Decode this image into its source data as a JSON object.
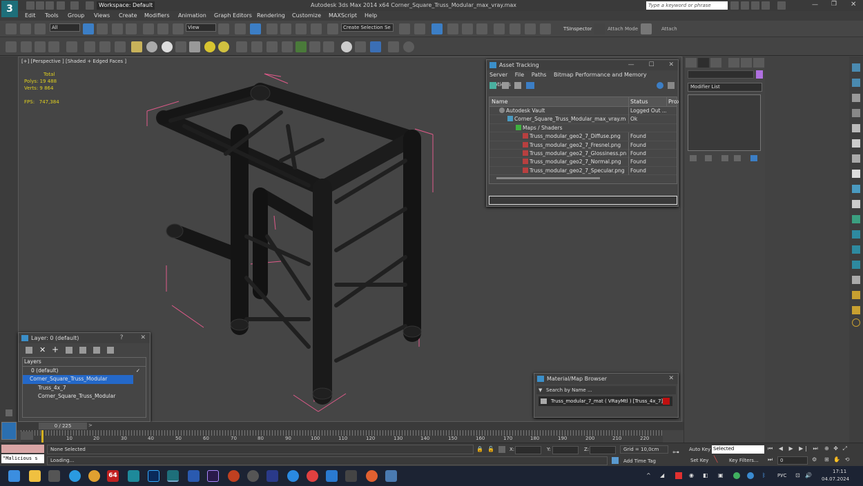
{
  "titlebar": {
    "app_logo": "3",
    "workspace": "Workspace: Default",
    "title": "Autodesk 3ds Max  2014 x64     Corner_Square_Truss_Modular_max_vray.max",
    "search_placeholder": "Type a keyword or phrase"
  },
  "menu": [
    "Edit",
    "Tools",
    "Group",
    "Views",
    "Create",
    "Modifiers",
    "Animation",
    "Graph Editors",
    "Rendering",
    "Customize",
    "MAXScript",
    "Help"
  ],
  "toolbar": {
    "filter": "All",
    "view": "View",
    "selection_set": "Create Selection Se",
    "ts_inspector": "TSInspector",
    "attach_mode": "Attach Mode",
    "attach": "Attach"
  },
  "viewport": {
    "label": "[+] [Perspective ] [Shaded + Edged Faces ]",
    "stats": {
      "total_label": "Total",
      "polys_label": "Polys:",
      "polys": "19 488",
      "verts_label": "Verts:",
      "verts": "9 864",
      "fps_label": "FPS:",
      "fps": "747,384"
    }
  },
  "asset_tracking": {
    "title": "Asset Tracking",
    "menu": [
      "Server",
      "File",
      "Paths",
      "Bitmap Performance and Memory",
      "Options"
    ],
    "columns": [
      "Name",
      "Status",
      "Prox"
    ],
    "rows": [
      {
        "name": "Autodesk Vault",
        "status": "Logged Out ...",
        "prox": ""
      },
      {
        "name": "Corner_Square_Truss_Modular_max_vray.max",
        "status": "Ok",
        "prox": ""
      },
      {
        "name": "Maps / Shaders",
        "status": "",
        "prox": ""
      },
      {
        "name": "Truss_modular_geo2_7_Diffuse.png",
        "status": "Found",
        "prox": ""
      },
      {
        "name": "Truss_modular_geo2_7_Fresnel.png",
        "status": "Found",
        "prox": ""
      },
      {
        "name": "Truss_modular_geo2_7_Glossiness.png",
        "status": "Found",
        "prox": ""
      },
      {
        "name": "Truss_modular_geo2_7_Normal.png",
        "status": "Found",
        "prox": ""
      },
      {
        "name": "Truss_modular_geo2_7_Specular.png",
        "status": "Found",
        "prox": ""
      }
    ]
  },
  "layers": {
    "title": "Layer: 0 (default)",
    "help": "?",
    "header": "Layers",
    "items": [
      "0 (default)",
      "Corner_Square_Truss_Modular",
      "Truss_4x_7",
      "Corner_Square_Truss_Modular"
    ]
  },
  "material_browser": {
    "title": "Material/Map Browser",
    "search_placeholder": "Search by Name ...",
    "item": "Truss_modular_7_mat  ( VRayMtl )  [Truss_4x_7]"
  },
  "command_panel": {
    "modifier_list": "Modifier List"
  },
  "timeline": {
    "frame": "0 / 225",
    "ticks": [
      "10",
      "20",
      "30",
      "40",
      "50",
      "60",
      "70",
      "80",
      "90",
      "100",
      "110",
      "120",
      "130",
      "140",
      "150",
      "160",
      "170",
      "180",
      "190",
      "200",
      "210",
      "220"
    ]
  },
  "status": {
    "script_listener": "\"Malicious s",
    "selection": "None Selected",
    "loading": "Loading...",
    "x_label": "X:",
    "y_label": "Y:",
    "z_label": "Z:",
    "grid": "Grid = 10,0cm",
    "add_time_tag": "Add Time Tag",
    "auto_key": "Auto Key",
    "set_key": "Set Key",
    "key_mode": "Selected",
    "key_filters": "Key Filters...",
    "frame_value": "0"
  },
  "taskbar": {
    "lang": "РУС",
    "time": "17:11",
    "date": "04.07.2024",
    "badge": "64"
  },
  "colors": {
    "accent": "#3c7ec5",
    "selection_blue": "#2468c8",
    "stats_yellow": "#e0d020",
    "bbox_pink": "#e05a8a",
    "material_red": "#c01010"
  }
}
